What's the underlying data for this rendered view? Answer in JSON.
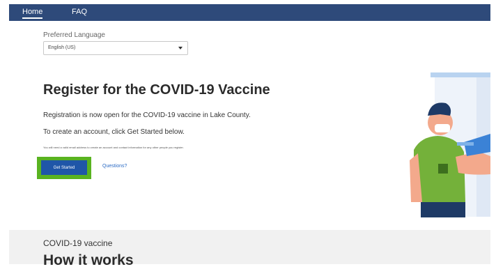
{
  "nav": {
    "home": "Home",
    "faq": "FAQ"
  },
  "language": {
    "label": "Preferred Language",
    "selected": "English (US)"
  },
  "hero": {
    "title": "Register for the COVID-19 Vaccine",
    "line1": "Registration is now open for the COVID-19 vaccine in Lake County.",
    "line2": "To create an account, click Get Started below.",
    "fine_print": "You will need a valid email address to create an account and contact information for any other people you register.",
    "get_started": "Get Started",
    "questions": "Questions?"
  },
  "how": {
    "subtitle": "COVID-19 vaccine",
    "heading": "How it works"
  },
  "colors": {
    "nav": "#2e4a7a",
    "button": "#1f56a8",
    "highlight": "#59b320",
    "link": "#2b6bc4"
  },
  "icons": {
    "select_caret": "chevron-down-icon",
    "illustration": "vaccination-illustration"
  }
}
